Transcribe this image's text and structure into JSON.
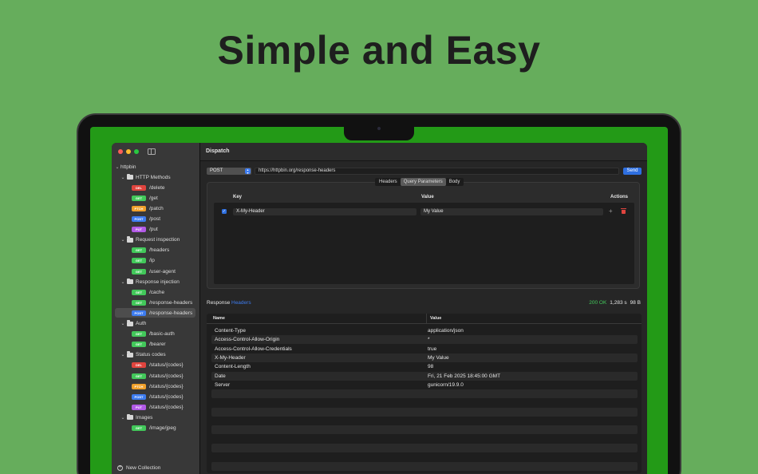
{
  "headline": "Simple and Easy",
  "window": {
    "title": "Dispatch"
  },
  "sidebar": {
    "collection": "httpbin",
    "groups": [
      {
        "name": "HTTP Methods",
        "items": [
          {
            "method": "DEL",
            "path": "/delete"
          },
          {
            "method": "GET",
            "path": "/get"
          },
          {
            "method": "PTCH",
            "path": "/patch"
          },
          {
            "method": "POST",
            "path": "/post"
          },
          {
            "method": "PUT",
            "path": "/put"
          }
        ]
      },
      {
        "name": "Request inspection",
        "items": [
          {
            "method": "GET",
            "path": "/headers"
          },
          {
            "method": "GET",
            "path": "/ip"
          },
          {
            "method": "GET",
            "path": "/user-agent"
          }
        ]
      },
      {
        "name": "Response injection",
        "items": [
          {
            "method": "GET",
            "path": "/cache"
          },
          {
            "method": "GET",
            "path": "/response-headers"
          },
          {
            "method": "POST",
            "path": "/response-headers",
            "selected": true
          }
        ]
      },
      {
        "name": "Auth",
        "items": [
          {
            "method": "GET",
            "path": "/basic-auth"
          },
          {
            "method": "GET",
            "path": "/bearer"
          }
        ]
      },
      {
        "name": "Status codes",
        "items": [
          {
            "method": "DEL",
            "path": "/status/{codes}"
          },
          {
            "method": "GET",
            "path": "/status/{codes}"
          },
          {
            "method": "PTCH",
            "path": "/status/{codes}"
          },
          {
            "method": "POST",
            "path": "/status/{codes}"
          },
          {
            "method": "PUT",
            "path": "/status/{codes}"
          }
        ]
      },
      {
        "name": "Images",
        "items": [
          {
            "method": "GET",
            "path": "/image/jpeg"
          }
        ]
      }
    ],
    "new_collection": "New Collection"
  },
  "method_colors": {
    "DEL": "#e0443e",
    "GET": "#42c85a",
    "PTCH": "#f0a02a",
    "POST": "#3d7cf0",
    "PUT": "#b25ae6"
  },
  "request": {
    "method": "POST",
    "url": "https://httpbin.org/response-headers",
    "send_label": "Send",
    "tabs": [
      "Headers",
      "Query Parameters",
      "Body"
    ],
    "active_tab": "Query Parameters"
  },
  "params": {
    "col_key": "Key",
    "col_value": "Value",
    "col_actions": "Actions",
    "rows": [
      {
        "enabled": true,
        "key": "X-My-Header",
        "value": "My Value"
      }
    ],
    "add_symbol": "+"
  },
  "response": {
    "label": "Response",
    "tab": "Headers",
    "status": "200 OK",
    "time": "1,283 s",
    "size": "98 B",
    "col_name": "Name",
    "col_value": "Value",
    "rows": [
      {
        "name": "Content-Type",
        "value": "application/json"
      },
      {
        "name": "Access-Control-Allow-Origin",
        "value": "*"
      },
      {
        "name": "Access-Control-Allow-Credentials",
        "value": "true"
      },
      {
        "name": "X-My-Header",
        "value": "My Value"
      },
      {
        "name": "Content-Length",
        "value": "98"
      },
      {
        "name": "Date",
        "value": "Fri, 21 Feb 2025 18:45:00 GMT"
      },
      {
        "name": "Server",
        "value": "gunicorn/19.9.0"
      }
    ]
  }
}
